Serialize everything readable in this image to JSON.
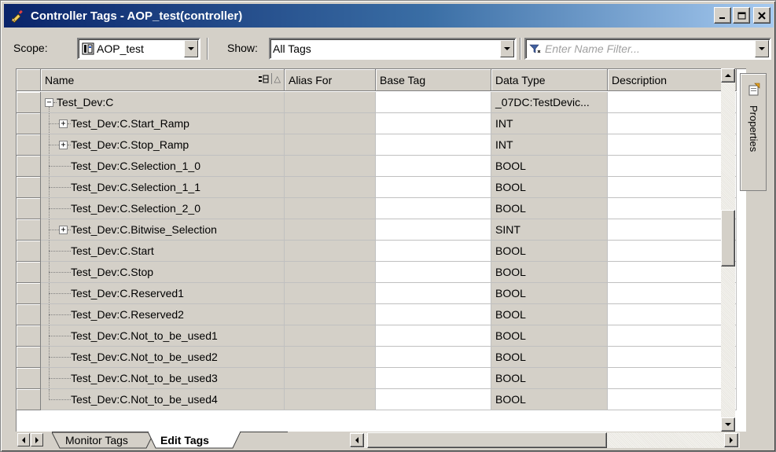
{
  "window": {
    "title": "Controller Tags - AOP_test(controller)"
  },
  "toolbar": {
    "scope_label": "Scope:",
    "scope_value": "AOP_test",
    "show_label": "Show:",
    "show_value": "All Tags",
    "filter_placeholder": "Enter Name Filter..."
  },
  "columns": {
    "name": "Name",
    "alias_for": "Alias For",
    "base_tag": "Base Tag",
    "data_type": "Data Type",
    "description": "Description"
  },
  "rows": [
    {
      "name": "Test_Dev:C",
      "data_type": "_07DC:TestDevic...",
      "expander": "minus",
      "level": 0
    },
    {
      "name": "Test_Dev:C.Start_Ramp",
      "data_type": "INT",
      "expander": "plus",
      "level": 1
    },
    {
      "name": "Test_Dev:C.Stop_Ramp",
      "data_type": "INT",
      "expander": "plus",
      "level": 1
    },
    {
      "name": "Test_Dev:C.Selection_1_0",
      "data_type": "BOOL",
      "expander": "none",
      "level": 1
    },
    {
      "name": "Test_Dev:C.Selection_1_1",
      "data_type": "BOOL",
      "expander": "none",
      "level": 1
    },
    {
      "name": "Test_Dev:C.Selection_2_0",
      "data_type": "BOOL",
      "expander": "none",
      "level": 1
    },
    {
      "name": "Test_Dev:C.Bitwise_Selection",
      "data_type": "SINT",
      "expander": "plus",
      "level": 1
    },
    {
      "name": "Test_Dev:C.Start",
      "data_type": "BOOL",
      "expander": "none",
      "level": 1
    },
    {
      "name": "Test_Dev:C.Stop",
      "data_type": "BOOL",
      "expander": "none",
      "level": 1
    },
    {
      "name": "Test_Dev:C.Reserved1",
      "data_type": "BOOL",
      "expander": "none",
      "level": 1
    },
    {
      "name": "Test_Dev:C.Reserved2",
      "data_type": "BOOL",
      "expander": "none",
      "level": 1
    },
    {
      "name": "Test_Dev:C.Not_to_be_used1",
      "data_type": "BOOL",
      "expander": "none",
      "level": 1
    },
    {
      "name": "Test_Dev:C.Not_to_be_used2",
      "data_type": "BOOL",
      "expander": "none",
      "level": 1
    },
    {
      "name": "Test_Dev:C.Not_to_be_used3",
      "data_type": "BOOL",
      "expander": "none",
      "level": 1
    },
    {
      "name": "Test_Dev:C.Not_to_be_used4",
      "data_type": "BOOL",
      "expander": "none",
      "level": 1
    }
  ],
  "side_panel": {
    "label": "Properties"
  },
  "tabs": {
    "monitor": "Monitor Tags",
    "edit": "Edit Tags"
  },
  "colors": {
    "title_start": "#0a246a",
    "title_end": "#a6caf0",
    "face": "#d4d0c8"
  }
}
